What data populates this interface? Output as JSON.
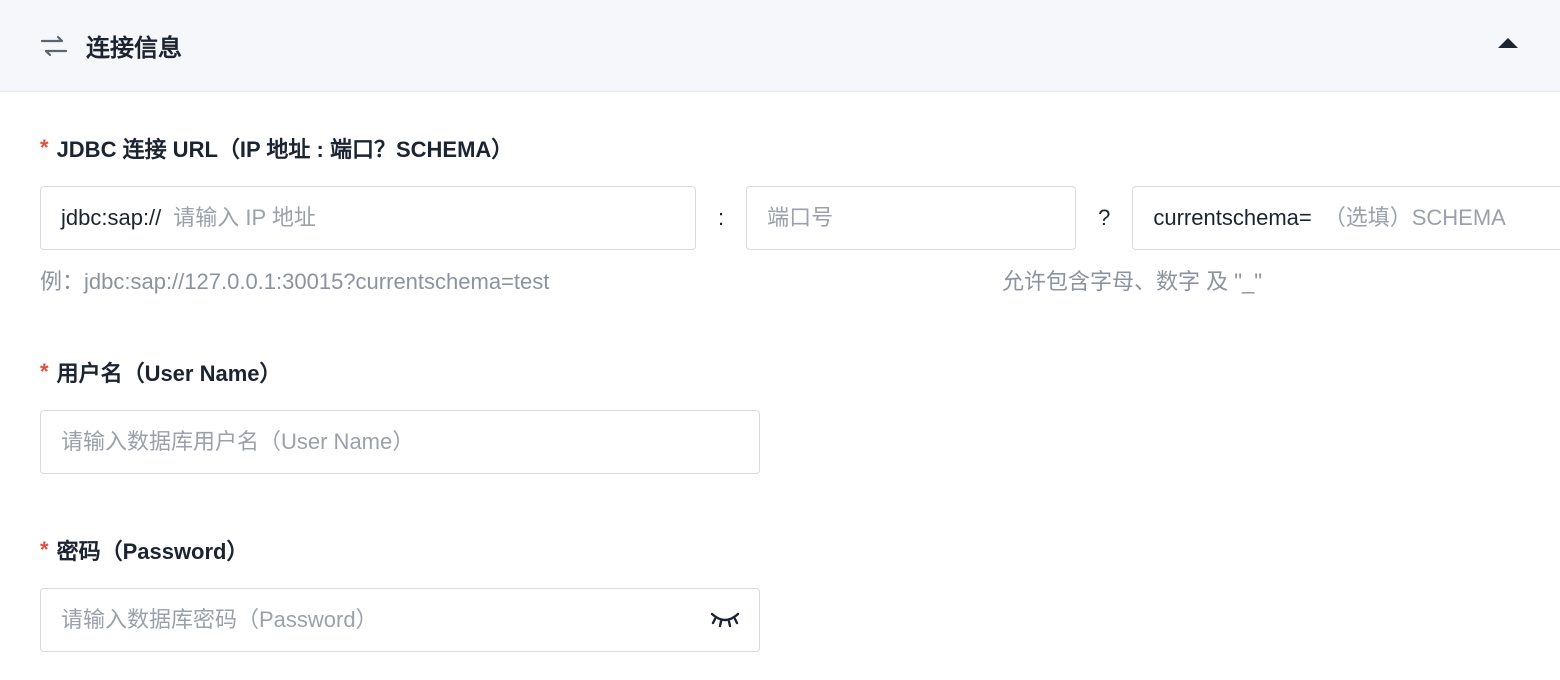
{
  "panel": {
    "title": "连接信息"
  },
  "jdbc": {
    "label": "JDBC 连接 URL（IP 地址 : 端口？SCHEMA）",
    "ip_prefix": "jdbc:sap://",
    "ip_placeholder": "请输入 IP 地址",
    "separator_colon": ":",
    "port_placeholder": "端口号",
    "separator_question": "?",
    "schema_prefix": "currentschema=",
    "schema_placeholder": "（选填）SCHEMA",
    "example_text": "例：jdbc:sap://127.0.0.1:30015?currentschema=test",
    "schema_helper": "允许包含字母、数字 及 \"_\""
  },
  "username": {
    "label": "用户名（User Name）",
    "placeholder": "请输入数据库用户名（User Name）"
  },
  "password": {
    "label": "密码（Password）",
    "placeholder": "请输入数据库密码（Password）"
  },
  "required_marker": "*"
}
